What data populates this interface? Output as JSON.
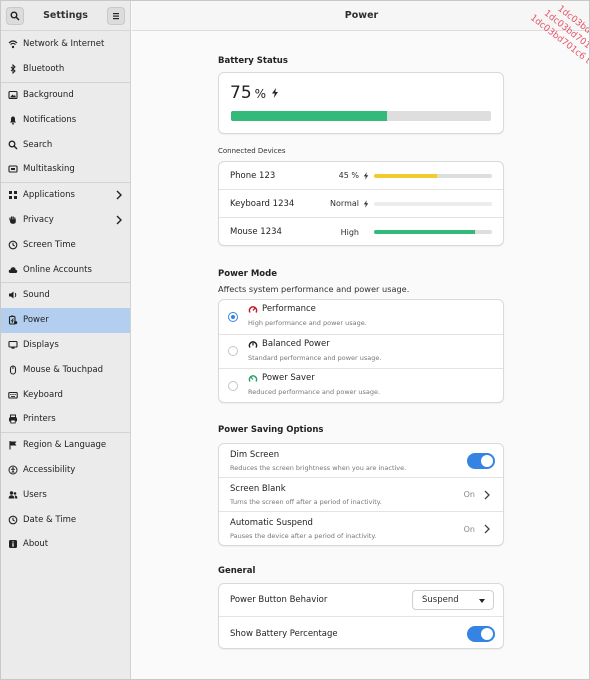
{
  "window": {
    "title": "Power"
  },
  "sidebar": {
    "title": "Settings",
    "items": [
      {
        "label": "Network & Internet",
        "icon": "network-icon"
      },
      {
        "label": "Bluetooth",
        "icon": "bluetooth-icon"
      },
      {
        "label": "Background",
        "icon": "background-icon"
      },
      {
        "label": "Notifications",
        "icon": "bell-icon"
      },
      {
        "label": "Search",
        "icon": "search-icon"
      },
      {
        "label": "Multitasking",
        "icon": "multitasking-icon"
      },
      {
        "label": "Applications",
        "icon": "apps-grid-icon"
      },
      {
        "label": "Privacy",
        "icon": "hand-icon"
      },
      {
        "label": "Screen Time",
        "icon": "clock-icon"
      },
      {
        "label": "Online Accounts",
        "icon": "cloud-icon"
      },
      {
        "label": "Sound",
        "icon": "speaker-icon"
      },
      {
        "label": "Power",
        "icon": "power-icon"
      },
      {
        "label": "Displays",
        "icon": "monitor-icon"
      },
      {
        "label": "Mouse & Touchpad",
        "icon": "mouse-icon"
      },
      {
        "label": "Keyboard",
        "icon": "keyboard-icon"
      },
      {
        "label": "Printers",
        "icon": "printer-icon"
      },
      {
        "label": "Region & Language",
        "icon": "flag-icon"
      },
      {
        "label": "Accessibility",
        "icon": "accessibility-icon"
      },
      {
        "label": "Users",
        "icon": "users-icon"
      },
      {
        "label": "Date & Time",
        "icon": "clock-icon"
      },
      {
        "label": "About",
        "icon": "info-icon"
      }
    ],
    "active": "Power"
  },
  "battery": {
    "section_title": "Battery Status",
    "percent": "75",
    "unit": "%",
    "level": 0.6
  },
  "devices": {
    "section_title": "Connected Devices",
    "items": [
      {
        "name": "Phone 123",
        "status": "45 %",
        "level": 0.53,
        "color": "#f2cc2d",
        "charging": true
      },
      {
        "name": "Keyboard 1234",
        "status": "Normal",
        "level": 0,
        "color": "#f2cc2d",
        "charging": true
      },
      {
        "name": "Mouse 1234",
        "status": "High",
        "level": 0.86,
        "color": "#33b97a",
        "charging": false
      }
    ]
  },
  "power_mode": {
    "title": "Power Mode",
    "subtitle": "Affects system performance and power usage.",
    "options": [
      {
        "label": "Performance",
        "desc": "High performance and power usage.",
        "selected": true,
        "icon": "speedometer-high-icon",
        "color": "#c01c28"
      },
      {
        "label": "Balanced Power",
        "desc": "Standard performance and power usage.",
        "selected": false,
        "icon": "speedometer-mid-icon",
        "color": "#222222"
      },
      {
        "label": "Power Saver",
        "desc": "Reduced performance and power usage.",
        "selected": false,
        "icon": "speedometer-low-icon",
        "color": "#26a269"
      }
    ]
  },
  "saving": {
    "title": "Power Saving Options",
    "dim": {
      "title": "Dim Screen",
      "desc": "Reduces the screen brightness when you are inactive.",
      "on": true
    },
    "blank": {
      "title": "Screen Blank",
      "desc": "Turns the screen off after a period of inactivity.",
      "value": "On"
    },
    "suspend": {
      "title": "Automatic Suspend",
      "desc": "Pauses the device after a period of inactivity.",
      "value": "On"
    }
  },
  "general": {
    "title": "General",
    "button_behavior": {
      "title": "Power Button Behavior",
      "value": "Suspend"
    },
    "show_percentage": {
      "title": "Show Battery Percentage",
      "on": true
    }
  },
  "watermark": "1dc03bd701c6 test v",
  "colors": {
    "accent": "#3584e4",
    "battery_green": "#33b97a",
    "sidebar_active": "#b3ceee"
  }
}
